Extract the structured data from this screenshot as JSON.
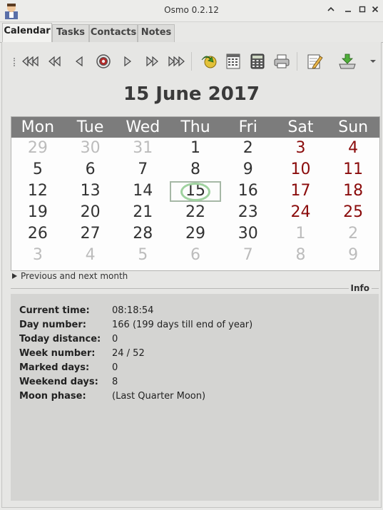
{
  "window": {
    "title": "Osmo 0.2.12"
  },
  "tabs": [
    {
      "label": "Calendar"
    },
    {
      "label": "Tasks"
    },
    {
      "label": "Contacts"
    },
    {
      "label": "Notes"
    }
  ],
  "toolbar": {
    "icons": [
      "prev-year-icon",
      "prev-month-icon",
      "prev-day-icon",
      "today-icon",
      "next-day-icon",
      "next-month-icon",
      "next-year-icon",
      "jump-to-date-icon",
      "calendar-info-icon",
      "calculator-icon",
      "print-icon",
      "edit-note-icon",
      "export-icon",
      "more-icon"
    ]
  },
  "calendar": {
    "title": "15 June 2017",
    "weekdays": [
      "Mon",
      "Tue",
      "Wed",
      "Thu",
      "Fri",
      "Sat",
      "Sun"
    ],
    "weeks": [
      [
        "29",
        "30",
        "31",
        "1",
        "2",
        "3",
        "4"
      ],
      [
        "5",
        "6",
        "7",
        "8",
        "9",
        "10",
        "11"
      ],
      [
        "12",
        "13",
        "14",
        "15",
        "16",
        "17",
        "18"
      ],
      [
        "19",
        "20",
        "21",
        "22",
        "23",
        "24",
        "25"
      ],
      [
        "26",
        "27",
        "28",
        "29",
        "30",
        "1",
        "2"
      ],
      [
        "3",
        "4",
        "5",
        "6",
        "7",
        "8",
        "9"
      ]
    ],
    "colors": {
      "weekend": "#8a0b0b",
      "other_month": "#bcbcbc",
      "header_bg": "#7c7c7c",
      "today_ring": "#9fd29f"
    }
  },
  "expander": {
    "label": "Previous and next month"
  },
  "info": {
    "frame_label": "Info",
    "rows": [
      {
        "key": "Current time:",
        "value": "08:18:54"
      },
      {
        "key": "Day number:",
        "value": "166 (199 days till end of year)"
      },
      {
        "key": "Today distance:",
        "value": "0"
      },
      {
        "key": "Week number:",
        "value": "24 / 52"
      },
      {
        "key": "Marked days:",
        "value": "0"
      },
      {
        "key": "Weekend days:",
        "value": "8"
      },
      {
        "key": "Moon phase:",
        "value": "(Last Quarter Moon)"
      }
    ]
  }
}
